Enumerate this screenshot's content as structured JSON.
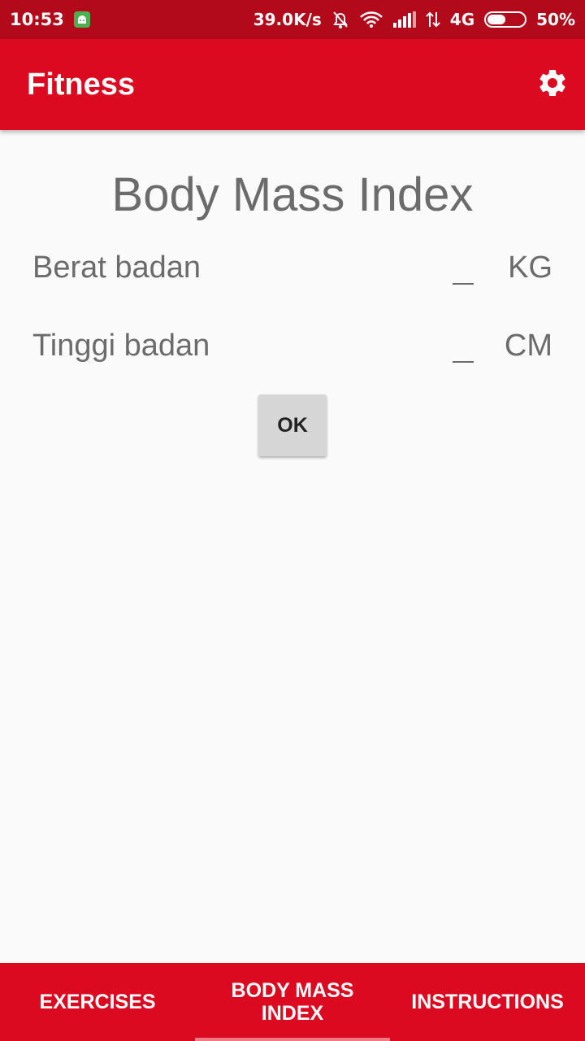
{
  "status_bar": {
    "time": "10:53",
    "net_speed": "39.0K/s",
    "network": "4G",
    "battery": "50%",
    "battery_level": 0.5,
    "icons": [
      "android-debug-icon",
      "bell-off-icon",
      "wifi-icon",
      "signal-icon",
      "data-arrows-icon",
      "battery-icon"
    ]
  },
  "app_bar": {
    "title": "Fitness",
    "settings_icon": "gear-icon"
  },
  "main": {
    "title": "Body Mass Index",
    "weight": {
      "label": "Berat badan",
      "value": "",
      "unit": "KG"
    },
    "height": {
      "label": "Tinggi badan",
      "value": "",
      "unit": "CM"
    },
    "ok_label": "OK"
  },
  "tabs": [
    {
      "label": "EXERCISES",
      "selected": false
    },
    {
      "label": "BODY MASS INDEX",
      "selected": true
    },
    {
      "label": "INSTRUCTIONS",
      "selected": false
    }
  ],
  "colors": {
    "status_bar": "#b20a1b",
    "primary": "#db0a20",
    "tab_indicator": "#f07a86",
    "text_secondary": "#6b6b6b",
    "background": "#fafafa"
  }
}
